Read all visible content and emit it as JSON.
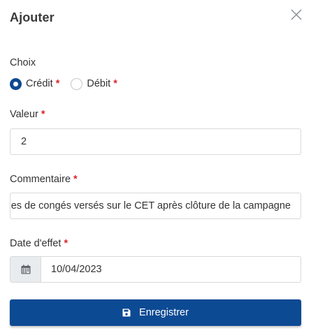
{
  "dialog": {
    "title": "Ajouter",
    "close_icon": "close-icon"
  },
  "choice": {
    "label": "Choix",
    "options": [
      {
        "label": "Crédit",
        "required_mark": "*",
        "checked": true
      },
      {
        "label": "Débit",
        "required_mark": "*",
        "checked": false
      }
    ]
  },
  "value_field": {
    "label": "Valeur",
    "required_mark": "*",
    "value": "2"
  },
  "comment_field": {
    "label": "Commentaire",
    "required_mark": "*",
    "value": "es de congés versés sur le CET après clôture de la campagne"
  },
  "date_field": {
    "label": "Date d'effet",
    "required_mark": "*",
    "icon": "calendar-icon",
    "value": "10/04/2023"
  },
  "save_button": {
    "label": "Enregistrer",
    "icon": "save-icon"
  },
  "colors": {
    "primary": "#0d4a94",
    "required": "#d9262c",
    "addon_bg": "#e9ecef"
  }
}
